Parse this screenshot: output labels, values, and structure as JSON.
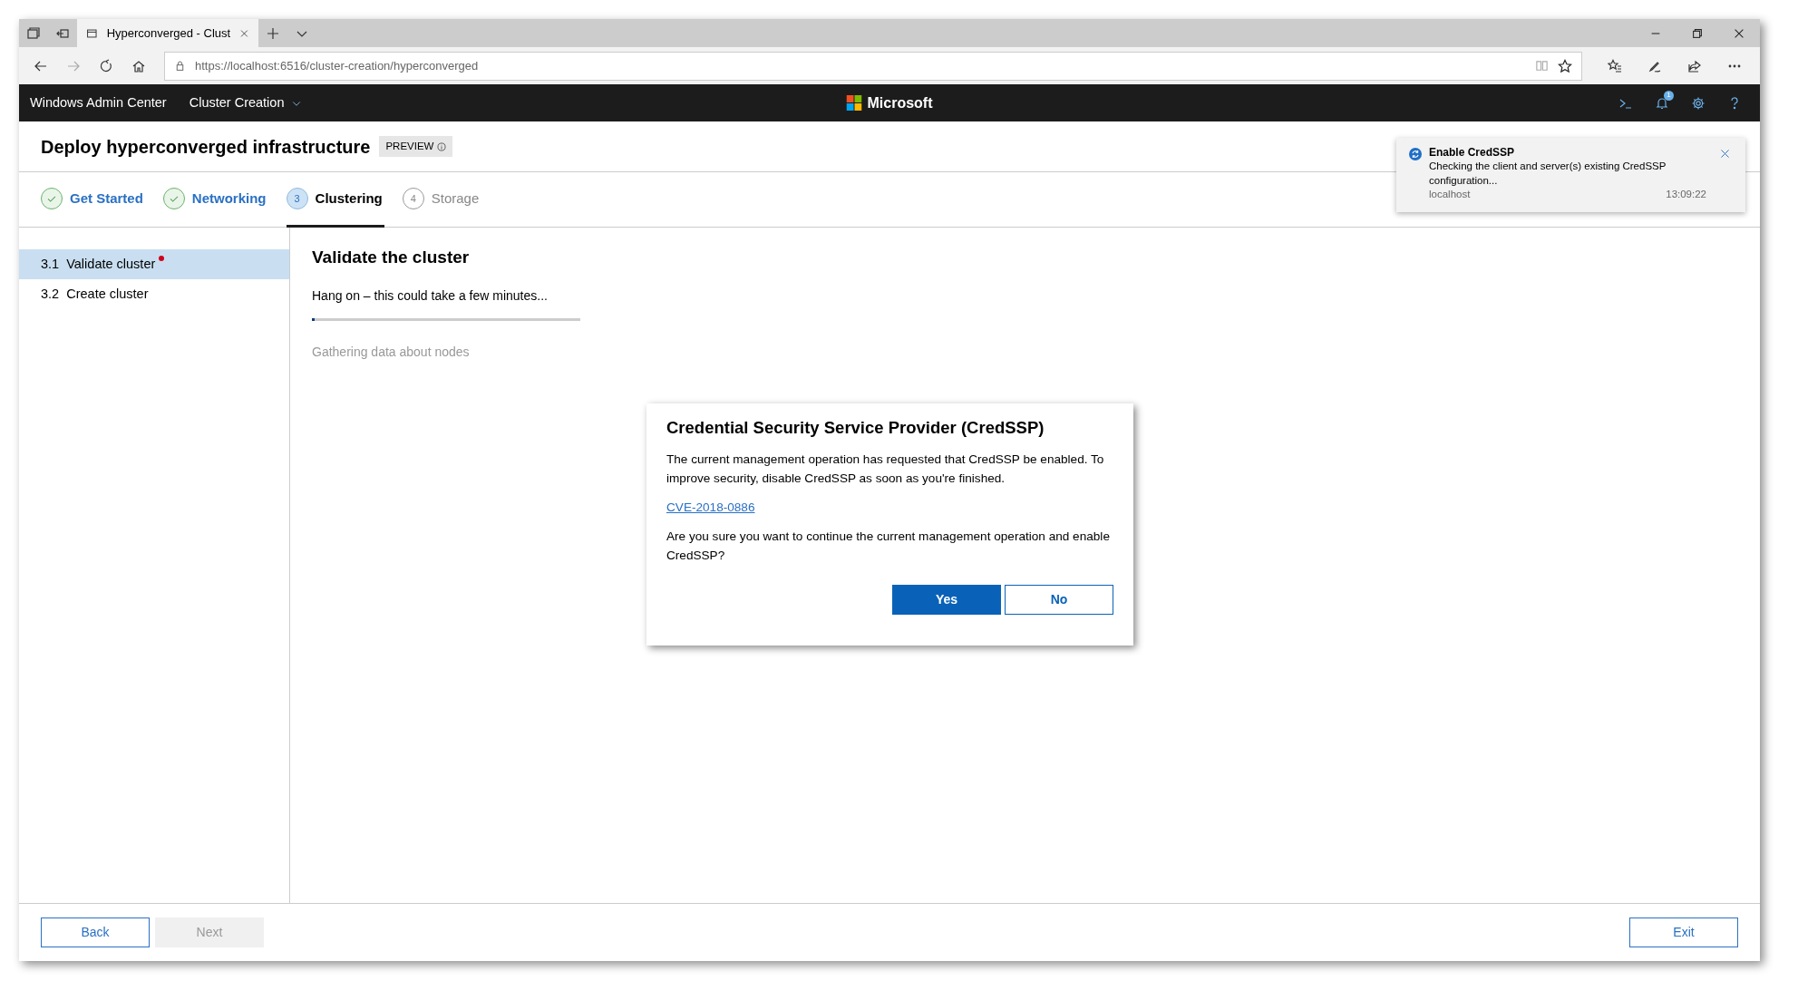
{
  "browser": {
    "tabs": [
      {
        "title": "Hyperconverged - Clust",
        "selected": true
      }
    ],
    "url": "https://localhost:6516/cluster-creation/hyperconverged"
  },
  "app_bar": {
    "app_name": "Windows Admin Center",
    "menu": "Cluster Creation",
    "brand": "Microsoft",
    "notification_count": "1"
  },
  "page": {
    "title": "Deploy hyperconverged infrastructure",
    "badge": "PREVIEW"
  },
  "steps": [
    {
      "label": "Get Started",
      "completed": true,
      "selected": false
    },
    {
      "label": "Networking",
      "completed": true,
      "selected": false
    },
    {
      "number": "3",
      "label": "Clustering",
      "completed": false,
      "selected": true
    },
    {
      "number": "4",
      "label": "Storage",
      "completed": false,
      "selected": false
    }
  ],
  "sidebar": {
    "items": [
      {
        "label": "3.1  Validate cluster",
        "selected": true,
        "flagged": true
      },
      {
        "label": "3.2  Create cluster",
        "selected": false,
        "flagged": false
      }
    ]
  },
  "content": {
    "heading": "Validate the cluster",
    "status": "Hang on – this could take a few minutes...",
    "progress": {
      "level": 0.01
    },
    "detail": "Gathering data about nodes"
  },
  "dialog": {
    "title": "Credential Security Service Provider (CredSSP)",
    "message": "The current management operation has requested that CredSSP be enabled. To improve security, disable CredSSP as soon as you're finished.",
    "link": "CVE-2018-0886",
    "question": "Are you sure you want to continue the current management operation and enable CredSSP?",
    "buttons": [
      {
        "label": "Yes",
        "primary": true
      },
      {
        "label": "No",
        "primary": false
      }
    ]
  },
  "notification": {
    "title": "Enable CredSSP",
    "message": "Checking the client and server(s) existing CredSSP configuration...",
    "source": "localhost",
    "time": "13:09:22"
  },
  "footer": {
    "buttons": [
      {
        "label": "Back",
        "disabled": false
      },
      {
        "label": "Next",
        "disabled": true
      },
      {
        "label": "Exit",
        "disabled": false
      }
    ]
  }
}
